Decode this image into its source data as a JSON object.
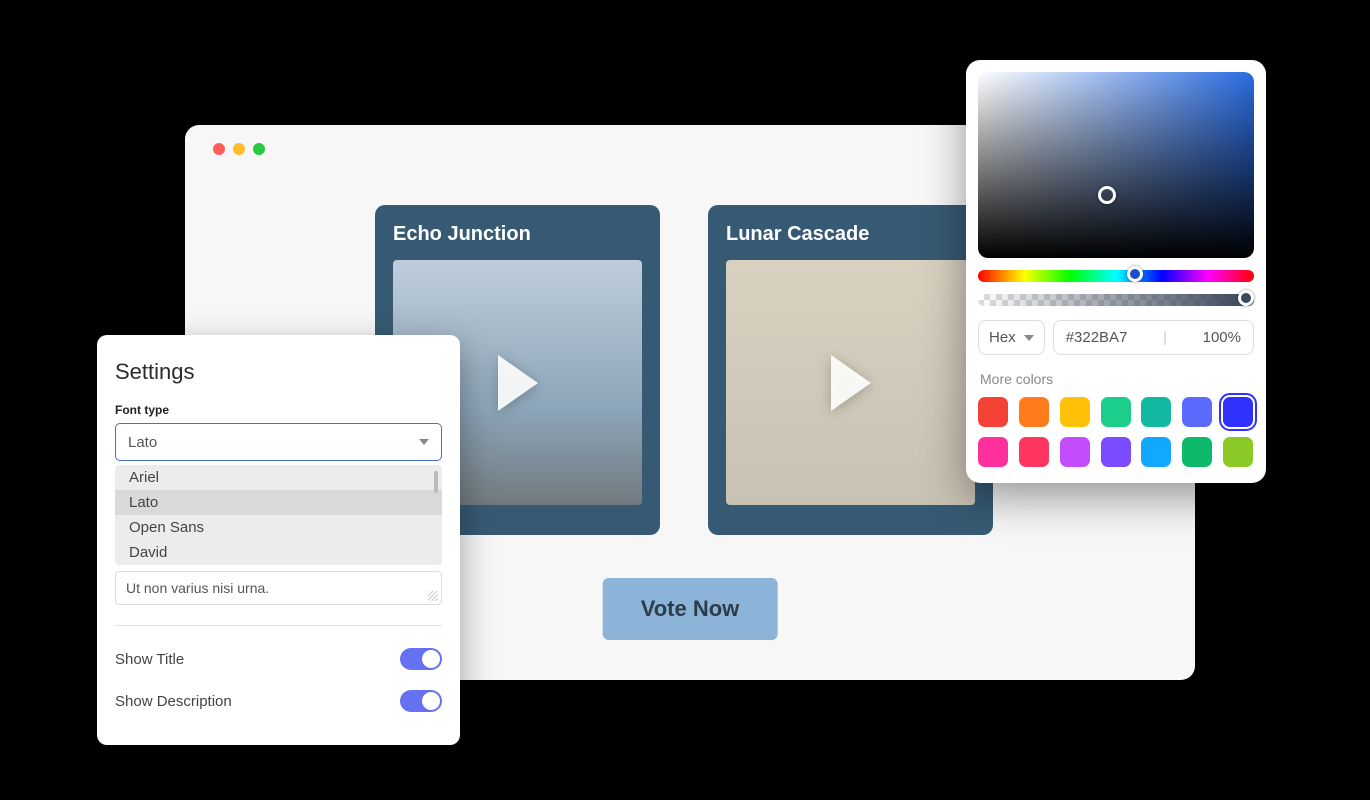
{
  "preview": {
    "cards": [
      {
        "title": "Echo Junction"
      },
      {
        "title": "Lunar Cascade"
      }
    ],
    "vote_button": "Vote Now"
  },
  "settings": {
    "title": "Settings",
    "font_type_label": "Font type",
    "font_selected": "Lato",
    "font_options": [
      "Ariel",
      "Lato",
      "Open Sans",
      "David"
    ],
    "textarea_value": "Ut non varius nisi urna.",
    "toggles": {
      "show_title_label": "Show Title",
      "show_title_on": true,
      "show_description_label": "Show Description",
      "show_description_on": true
    }
  },
  "color_picker": {
    "format": "Hex",
    "hex_value": "#322BA7",
    "opacity": "100%",
    "more_colors_label": "More colors",
    "swatches": [
      "#f44336",
      "#ff7b1c",
      "#ffc107",
      "#1bce8c",
      "#12b8a0",
      "#5b6bff",
      "#3030ff",
      "#ff2f9b",
      "#ff3562",
      "#c34cff",
      "#7b4cff",
      "#12a8ff",
      "#0fb96b",
      "#8ac926"
    ],
    "selected_swatch_index": 6
  }
}
